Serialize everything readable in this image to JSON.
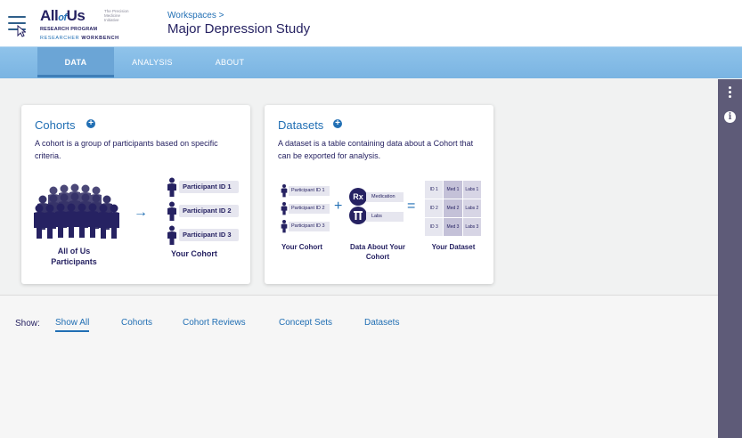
{
  "header": {
    "logo": {
      "main": "All of Us",
      "tagline": "The Precision Medicine Initiative",
      "program": "RESEARCH PROGRAM",
      "workbench_prefix": "RESEARCHER",
      "workbench_suffix": "WORKBENCH"
    },
    "breadcrumb": "Workspaces >",
    "title": "Major Depression Study"
  },
  "tabs": [
    {
      "label": "DATA",
      "active": true
    },
    {
      "label": "ANALYSIS",
      "active": false
    },
    {
      "label": "ABOUT",
      "active": false
    }
  ],
  "cohorts_card": {
    "title": "Cohorts",
    "description": "A cohort is a group of participants based on specific criteria.",
    "crowd_label": "All of Us Participants",
    "participants": [
      "Participant ID 1",
      "Participant ID 2",
      "Participant ID 3"
    ],
    "result_label": "Your Cohort"
  },
  "datasets_card": {
    "title": "Datasets",
    "description": "A dataset is a table containing data about a Cohort that can be exported for analysis.",
    "participants": [
      "Participant ID 1",
      "Participant ID 2",
      "Participant ID 3"
    ],
    "rx_icon": "Rx",
    "data_items": [
      "Medication",
      "Labs"
    ],
    "grid": [
      [
        "ID 1",
        "Med 1",
        "Labs 1"
      ],
      [
        "ID 2",
        "Med 2",
        "Labs 2"
      ],
      [
        "ID 3",
        "Med 3",
        "Labs 3"
      ]
    ],
    "labels": {
      "cohort": "Your Cohort",
      "data": "Data About Your Cohort",
      "dataset": "Your Dataset"
    }
  },
  "resources": {
    "show_label": "Show:",
    "filters": [
      {
        "label": "Show All",
        "active": true
      },
      {
        "label": "Cohorts",
        "active": false
      },
      {
        "label": "Cohort Reviews",
        "active": false
      },
      {
        "label": "Concept Sets",
        "active": false
      },
      {
        "label": "Datasets",
        "active": false
      }
    ]
  },
  "colors": {
    "navy": "#262262",
    "blue": "#216fb4",
    "tabbar": "#7ab4e2",
    "rail": "#5e5b78"
  }
}
